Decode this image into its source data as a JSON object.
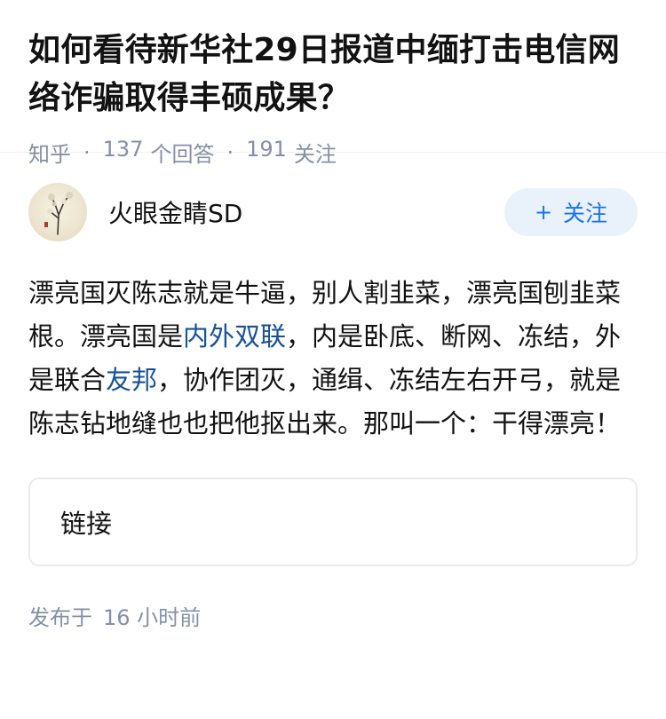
{
  "question": {
    "title": "如何看待新华社29日报道中缅打击电信网络诈骗取得丰硕成果？",
    "source": "知乎",
    "separator": "·",
    "answer_count": "137",
    "answer_label": "个回答",
    "follower_count": "191",
    "follower_label": "关注"
  },
  "answer": {
    "author_name": "火眼金睛SD",
    "follow_button": {
      "icon": "+",
      "label": "关注"
    },
    "content": {
      "seg1": "漂亮国灭陈志就是牛逼，别人割韭菜，漂亮国刨韭菜根。漂亮国是",
      "link1": "内外双联",
      "seg2": "，内是卧底、断网、冻结，外是联合",
      "link2": "友邦",
      "seg3": "，协作团灭，通缉、冻结左右开弓，就是陈志钻地缝也也把他抠出来。那叫一个：干得漂亮！"
    },
    "link_card_label": "链接",
    "publish_label": "发布于",
    "publish_time": "16 小时前"
  },
  "colors": {
    "link": "#175199",
    "accent": "#1772f6",
    "meta": "#8590a6",
    "follow_bg": "#e9f1fb"
  },
  "icons": {
    "avatar": "ink-painting-tree-avatar",
    "follow": "plus-icon"
  }
}
